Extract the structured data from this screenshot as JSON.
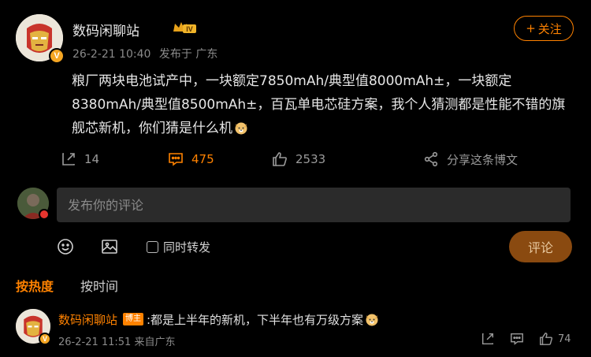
{
  "post": {
    "author": "数码闲聊站",
    "level_badge": "IV",
    "time": "26-2-21 10:40",
    "source": "发布于 广东",
    "follow_label": "关注",
    "follow_plus": "+",
    "text": "粮厂两块电池试产中，一块额定7850mAh/典型值8000mAh±，一块额定8380mAh/典型值8500mAh±，百瓦单电芯硅方案，我个人猜测都是性能不错的旗舰芯新机，你们猜是什么机",
    "verified_mark": "V"
  },
  "actions": {
    "repost_count": "14",
    "comment_count": "475",
    "like_count": "2533",
    "share_label": "分享这条博文"
  },
  "compose": {
    "placeholder": "发布你的评论",
    "also_repost_label": "同时转发",
    "submit_label": "评论"
  },
  "sort": {
    "hot_label": "按热度",
    "time_label": "按时间"
  },
  "comments": [
    {
      "author": "数码闲聊站",
      "tag": "博主",
      "text": ":都是上半年的新机，下半年也有万级方案",
      "time": "26-2-21 11:51",
      "location": "来自广东",
      "like_count": "74",
      "verified_mark": "V"
    }
  ],
  "colors": {
    "accent": "#ff8200",
    "background": "#000000",
    "input_bg": "#2b2b2b",
    "submit_bg": "#8a4a10"
  },
  "icons": {
    "repost": "repost-icon",
    "comment": "comment-icon",
    "like": "thumbs-up-icon",
    "share": "share-icon",
    "emoji": "smiley-icon",
    "image": "image-icon",
    "doge": "doge-emoji"
  }
}
